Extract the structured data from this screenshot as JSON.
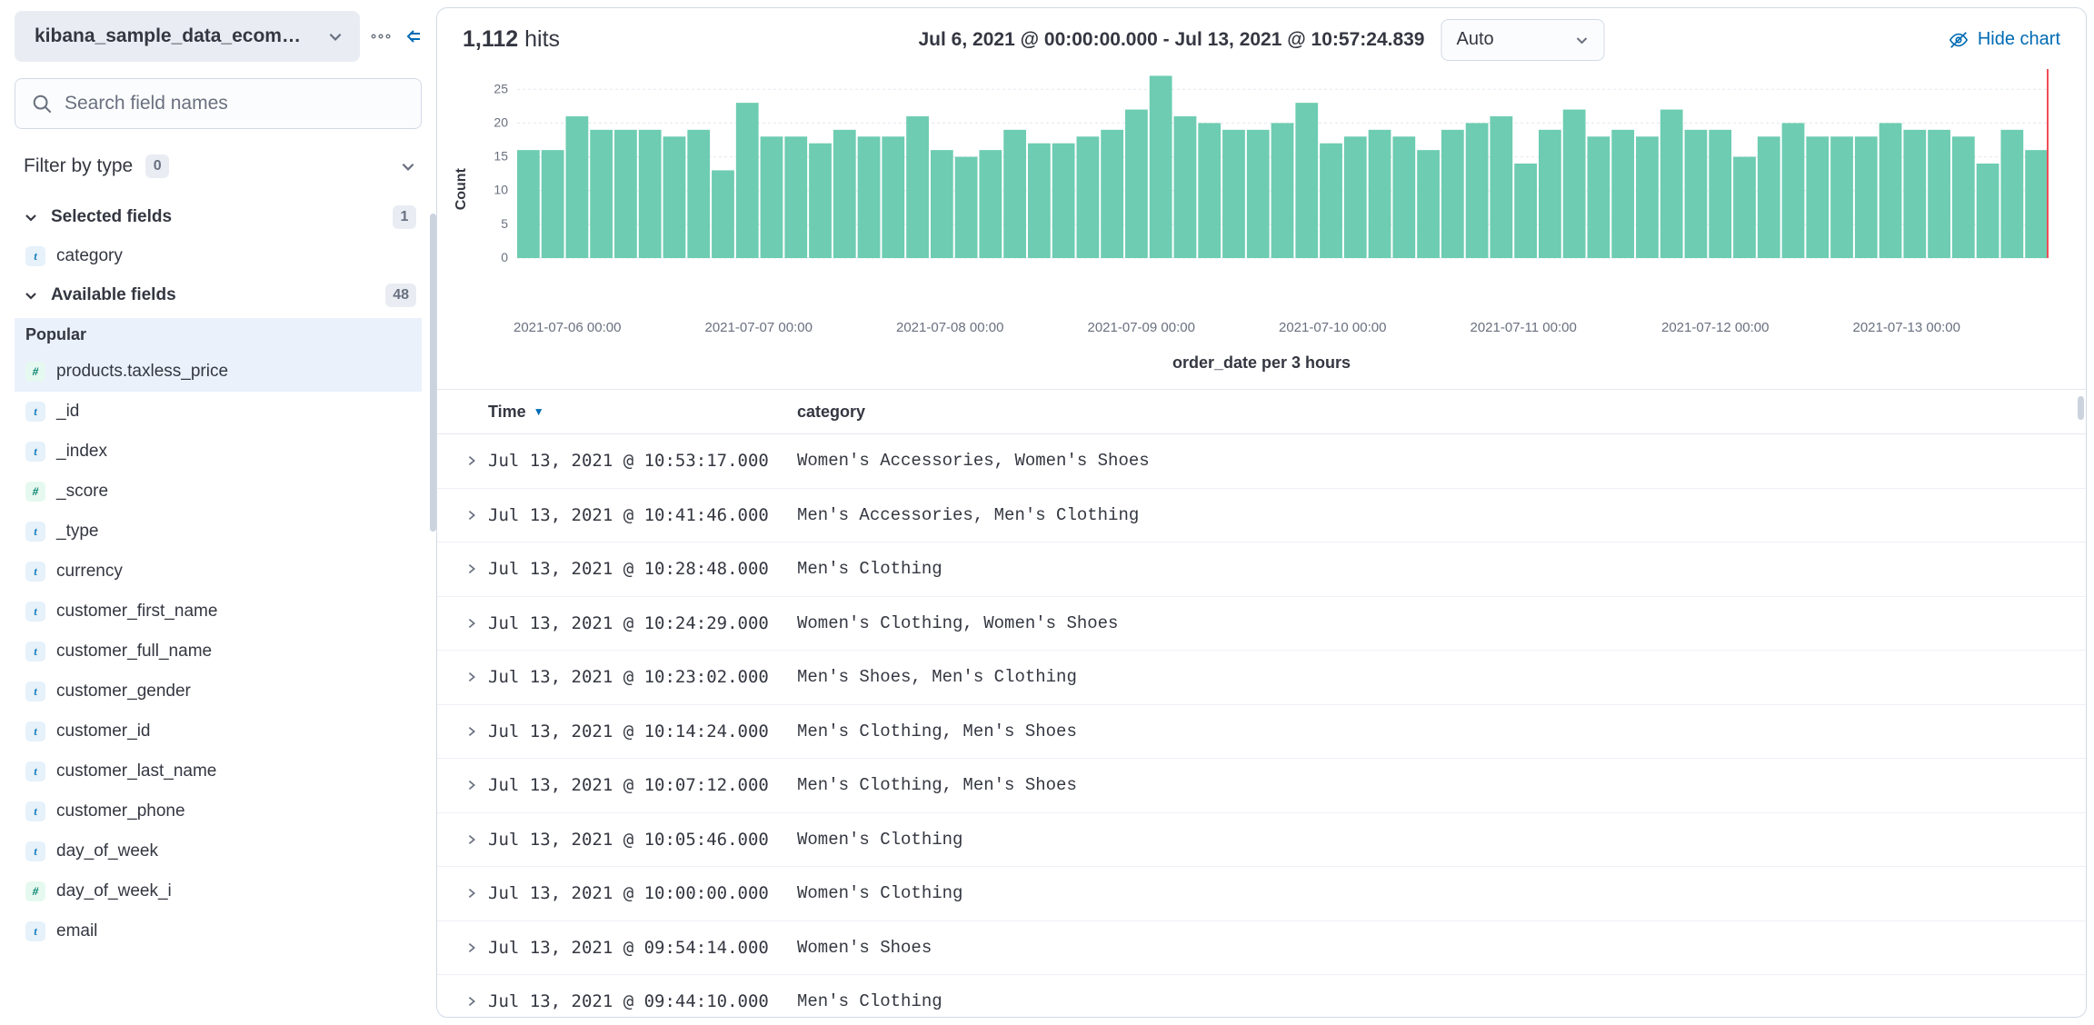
{
  "sidebar": {
    "index_pattern": "kibana_sample_data_ecom…",
    "search_placeholder": "Search field names",
    "filter_by_type_label": "Filter by type",
    "filter_by_type_count": "0",
    "selected_fields_label": "Selected fields",
    "selected_fields_count": "1",
    "selected_fields": [
      {
        "type": "t",
        "name": "category"
      }
    ],
    "available_fields_label": "Available fields",
    "available_fields_count": "48",
    "popular_label": "Popular",
    "popular_fields": [
      {
        "type": "n",
        "name": "products.taxless_price"
      }
    ],
    "available_fields": [
      {
        "type": "t",
        "name": "_id"
      },
      {
        "type": "t",
        "name": "_index"
      },
      {
        "type": "n",
        "name": "_score"
      },
      {
        "type": "t",
        "name": "_type"
      },
      {
        "type": "t",
        "name": "currency"
      },
      {
        "type": "t",
        "name": "customer_first_name"
      },
      {
        "type": "t",
        "name": "customer_full_name"
      },
      {
        "type": "t",
        "name": "customer_gender"
      },
      {
        "type": "t",
        "name": "customer_id"
      },
      {
        "type": "t",
        "name": "customer_last_name"
      },
      {
        "type": "t",
        "name": "customer_phone"
      },
      {
        "type": "t",
        "name": "day_of_week"
      },
      {
        "type": "n",
        "name": "day_of_week_i"
      },
      {
        "type": "t",
        "name": "email"
      }
    ]
  },
  "histogram": {
    "hits_count": "1,112",
    "hits_label": " hits",
    "time_range": "Jul 6, 2021 @ 00:00:00.000 - Jul 13, 2021 @ 10:57:24.839",
    "interval_selected": "Auto",
    "hide_chart_label": "Hide chart",
    "y_axis_label": "Count",
    "x_axis_label": "order_date per 3 hours"
  },
  "chart_data": {
    "type": "bar",
    "xlabel": "order_date per 3 hours",
    "ylabel": "Count",
    "ylim": [
      0,
      28
    ],
    "y_ticks": [
      0,
      5,
      10,
      15,
      20,
      25
    ],
    "x_tick_labels": [
      "2021-07-06 00:00",
      "2021-07-07 00:00",
      "2021-07-08 00:00",
      "2021-07-09 00:00",
      "2021-07-10 00:00",
      "2021-07-11 00:00",
      "2021-07-12 00:00",
      "2021-07-13 00:00"
    ],
    "values": [
      16,
      16,
      21,
      19,
      19,
      19,
      18,
      19,
      13,
      23,
      18,
      18,
      17,
      19,
      18,
      18,
      21,
      16,
      15,
      16,
      19,
      17,
      17,
      18,
      19,
      22,
      27,
      21,
      20,
      19,
      19,
      20,
      23,
      17,
      18,
      19,
      18,
      16,
      19,
      20,
      21,
      14,
      19,
      22,
      18,
      19,
      18,
      22,
      19,
      19,
      15,
      18,
      20,
      18,
      18,
      18,
      20,
      19,
      19,
      18,
      14,
      19,
      16
    ],
    "cursor_index": 62,
    "bar_color": "#6dccb1",
    "grid_color": "#e4e8ee"
  },
  "table": {
    "columns": {
      "time": "Time",
      "category": "category"
    },
    "rows": [
      {
        "time": "Jul 13, 2021 @ 10:53:17.000",
        "category": "Women's Accessories, Women's Shoes"
      },
      {
        "time": "Jul 13, 2021 @ 10:41:46.000",
        "category": "Men's Accessories, Men's Clothing"
      },
      {
        "time": "Jul 13, 2021 @ 10:28:48.000",
        "category": "Men's Clothing"
      },
      {
        "time": "Jul 13, 2021 @ 10:24:29.000",
        "category": "Women's Clothing, Women's Shoes"
      },
      {
        "time": "Jul 13, 2021 @ 10:23:02.000",
        "category": "Men's Shoes, Men's Clothing"
      },
      {
        "time": "Jul 13, 2021 @ 10:14:24.000",
        "category": "Men's Clothing, Men's Shoes"
      },
      {
        "time": "Jul 13, 2021 @ 10:07:12.000",
        "category": "Men's Clothing, Men's Shoes"
      },
      {
        "time": "Jul 13, 2021 @ 10:05:46.000",
        "category": "Women's Clothing"
      },
      {
        "time": "Jul 13, 2021 @ 10:00:00.000",
        "category": "Women's Clothing"
      },
      {
        "time": "Jul 13, 2021 @ 09:54:14.000",
        "category": "Women's Shoes"
      },
      {
        "time": "Jul 13, 2021 @ 09:44:10.000",
        "category": "Men's Clothing"
      }
    ]
  }
}
